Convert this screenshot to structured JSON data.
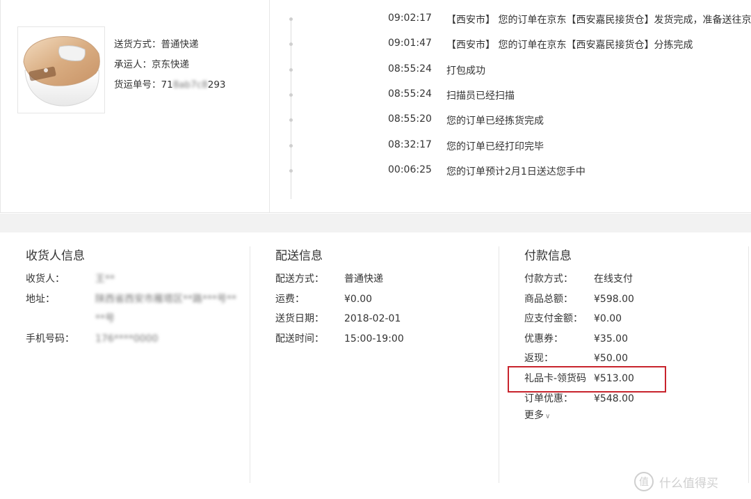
{
  "shipping": {
    "method_label": "送货方式：",
    "method_value": "普通快递",
    "carrier_label": "承运人：",
    "carrier_value": "京东快递",
    "tracking_label": "货运单号：",
    "tracking_prefix": "71",
    "tracking_hidden": "8ab7c8",
    "tracking_suffix": "293"
  },
  "timeline": [
    {
      "time": "09:02:17",
      "text": "【西安市】 您的订单在京东【西安嘉民接货仓】发货完成，准备送往京"
    },
    {
      "time": "09:01:47",
      "text": "【西安市】 您的订单在京东【西安嘉民接货仓】分拣完成"
    },
    {
      "time": "08:55:24",
      "text": "打包成功"
    },
    {
      "time": "08:55:24",
      "text": "扫描员已经扫描"
    },
    {
      "time": "08:55:20",
      "text": "您的订单已经拣货完成"
    },
    {
      "time": "08:32:17",
      "text": "您的订单已经打印完毕"
    },
    {
      "time": "00:06:25",
      "text": "您的订单预计2月1日送达您手中"
    }
  ],
  "receiver": {
    "title": "收货人信息",
    "name_label": "收货人：",
    "name_value": "王**",
    "address_label": "地址：",
    "address_line1": "陕西省西安市雁塔区**路***号**",
    "address_line2": "**号",
    "phone_label": "手机号码：",
    "phone_value": "176****0000"
  },
  "delivery": {
    "title": "配送信息",
    "method_label": "配送方式：",
    "method_value": "普通快递",
    "fee_label": "运费：",
    "fee_value": "¥0.00",
    "date_label": "送货日期：",
    "date_value": "2018-02-01",
    "time_label": "配送时间：",
    "time_value": "15:00-19:00"
  },
  "payment": {
    "title": "付款信息",
    "rows": [
      {
        "label": "付款方式：",
        "value": "在线支付"
      },
      {
        "label": "商品总额：",
        "value": "¥598.00"
      },
      {
        "label": "应支付金额：",
        "value": "¥0.00"
      },
      {
        "label": "优惠券：",
        "value": "¥35.00"
      },
      {
        "label": "返现：",
        "value": "¥50.00"
      },
      {
        "label": "礼品卡-领货码",
        "value": "¥513.00"
      },
      {
        "label": "订单优惠：",
        "value": "¥548.00"
      }
    ],
    "more_label": "更多",
    "more_icon": "chevron-down-icon"
  },
  "watermark": {
    "glyph": "值",
    "text": "什么值得买"
  },
  "colors": {
    "highlight": "#c8232c",
    "divider": "#e6e6e6",
    "band": "#f2f2f2"
  }
}
